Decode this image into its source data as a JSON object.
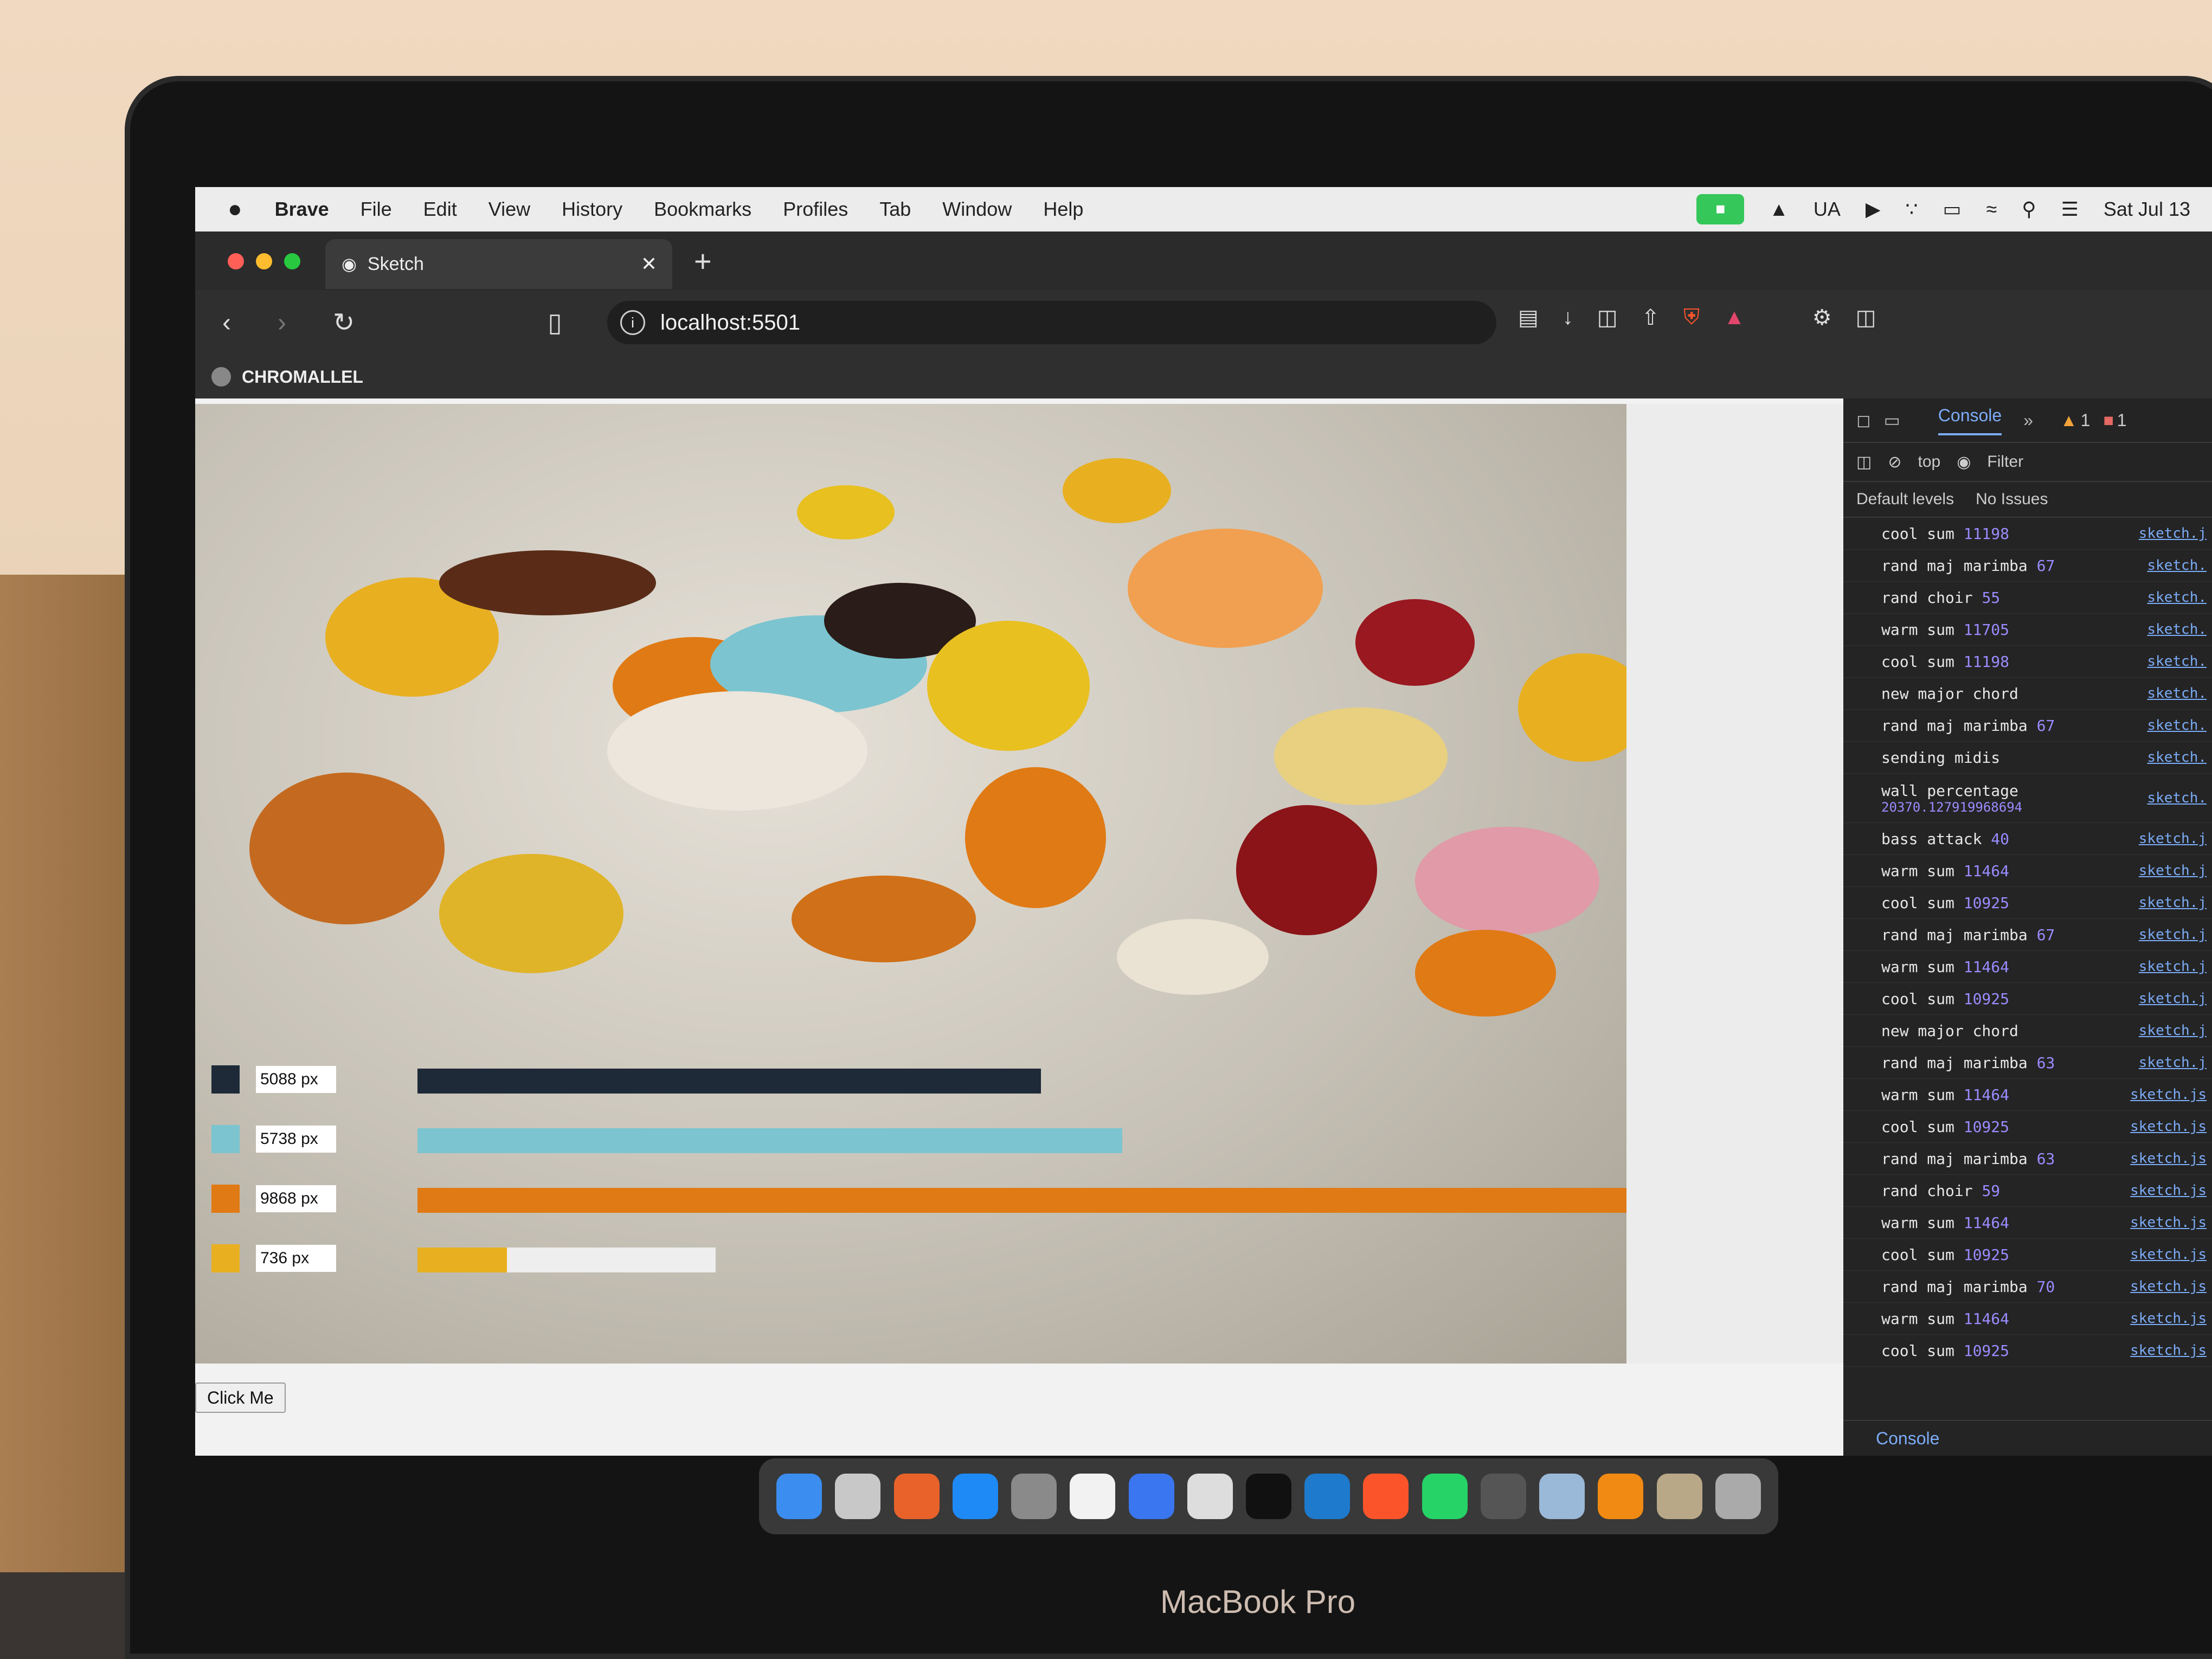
{
  "menubar": {
    "apple": "",
    "items": [
      "Brave",
      "File",
      "Edit",
      "View",
      "History",
      "Bookmarks",
      "Profiles",
      "Tab",
      "Window",
      "Help"
    ],
    "status": [
      "UA",
      "Sat Jul 13"
    ]
  },
  "browser": {
    "tab_title": "Sketch",
    "url": "localhost:5501",
    "bookmark_label": "CHROMALLEL"
  },
  "page": {
    "button_label": "Click Me",
    "bars": [
      {
        "label": "5088 px",
        "color": "#1e2a38",
        "fill": 0.44
      },
      {
        "label": "5738 px",
        "color": "#7cc4d0",
        "fill": 0.5
      },
      {
        "label": "9868 px",
        "color": "#e07a14",
        "fill": 0.86
      },
      {
        "label": "736 px",
        "color": "#e8b020",
        "fill": 0.064
      }
    ]
  },
  "devtools": {
    "tab": "Console",
    "context": "top",
    "filter": "Filter",
    "levels": "Default levels",
    "issues": "No Issues",
    "warn_count": "1",
    "error_count": "1",
    "bottom_tab": "Console",
    "logs": [
      {
        "text": "cool sum",
        "num": "11198",
        "src": "sketch.j"
      },
      {
        "text": "rand maj marimba",
        "num": "67",
        "src": "sketch."
      },
      {
        "text": "rand choir",
        "num": "55",
        "src": "sketch."
      },
      {
        "text": "warm sum",
        "num": "11705",
        "src": "sketch."
      },
      {
        "text": "cool sum",
        "num": "11198",
        "src": "sketch."
      },
      {
        "text": "new major chord",
        "num": "",
        "src": "sketch."
      },
      {
        "text": "rand maj marimba",
        "num": "67",
        "src": "sketch."
      },
      {
        "text": "sending midis",
        "num": "",
        "src": "sketch."
      },
      {
        "text": "wall percentage",
        "num": "20370.127919968694",
        "src": "sketch."
      },
      {
        "text": "bass attack",
        "num": "40",
        "src": "sketch.j"
      },
      {
        "text": "warm sum",
        "num": "11464",
        "src": "sketch.j"
      },
      {
        "text": "cool sum",
        "num": "10925",
        "src": "sketch.j"
      },
      {
        "text": "rand maj marimba",
        "num": "67",
        "src": "sketch.j"
      },
      {
        "text": "warm sum",
        "num": "11464",
        "src": "sketch.j"
      },
      {
        "text": "cool sum",
        "num": "10925",
        "src": "sketch.j"
      },
      {
        "text": "new major chord",
        "num": "",
        "src": "sketch.j"
      },
      {
        "text": "rand maj marimba",
        "num": "63",
        "src": "sketch.j"
      },
      {
        "text": "warm sum",
        "num": "11464",
        "src": "sketch.js"
      },
      {
        "text": "cool sum",
        "num": "10925",
        "src": "sketch.js"
      },
      {
        "text": "rand maj marimba",
        "num": "63",
        "src": "sketch.js"
      },
      {
        "text": "rand choir",
        "num": "59",
        "src": "sketch.js"
      },
      {
        "text": "warm sum",
        "num": "11464",
        "src": "sketch.js"
      },
      {
        "text": "cool sum",
        "num": "10925",
        "src": "sketch.js"
      },
      {
        "text": "rand maj marimba",
        "num": "70",
        "src": "sketch.js"
      },
      {
        "text": "warm sum",
        "num": "11464",
        "src": "sketch.js"
      },
      {
        "text": "cool sum",
        "num": "10925",
        "src": "sketch.js"
      }
    ]
  },
  "laptop_brand": "MacBook Pro"
}
